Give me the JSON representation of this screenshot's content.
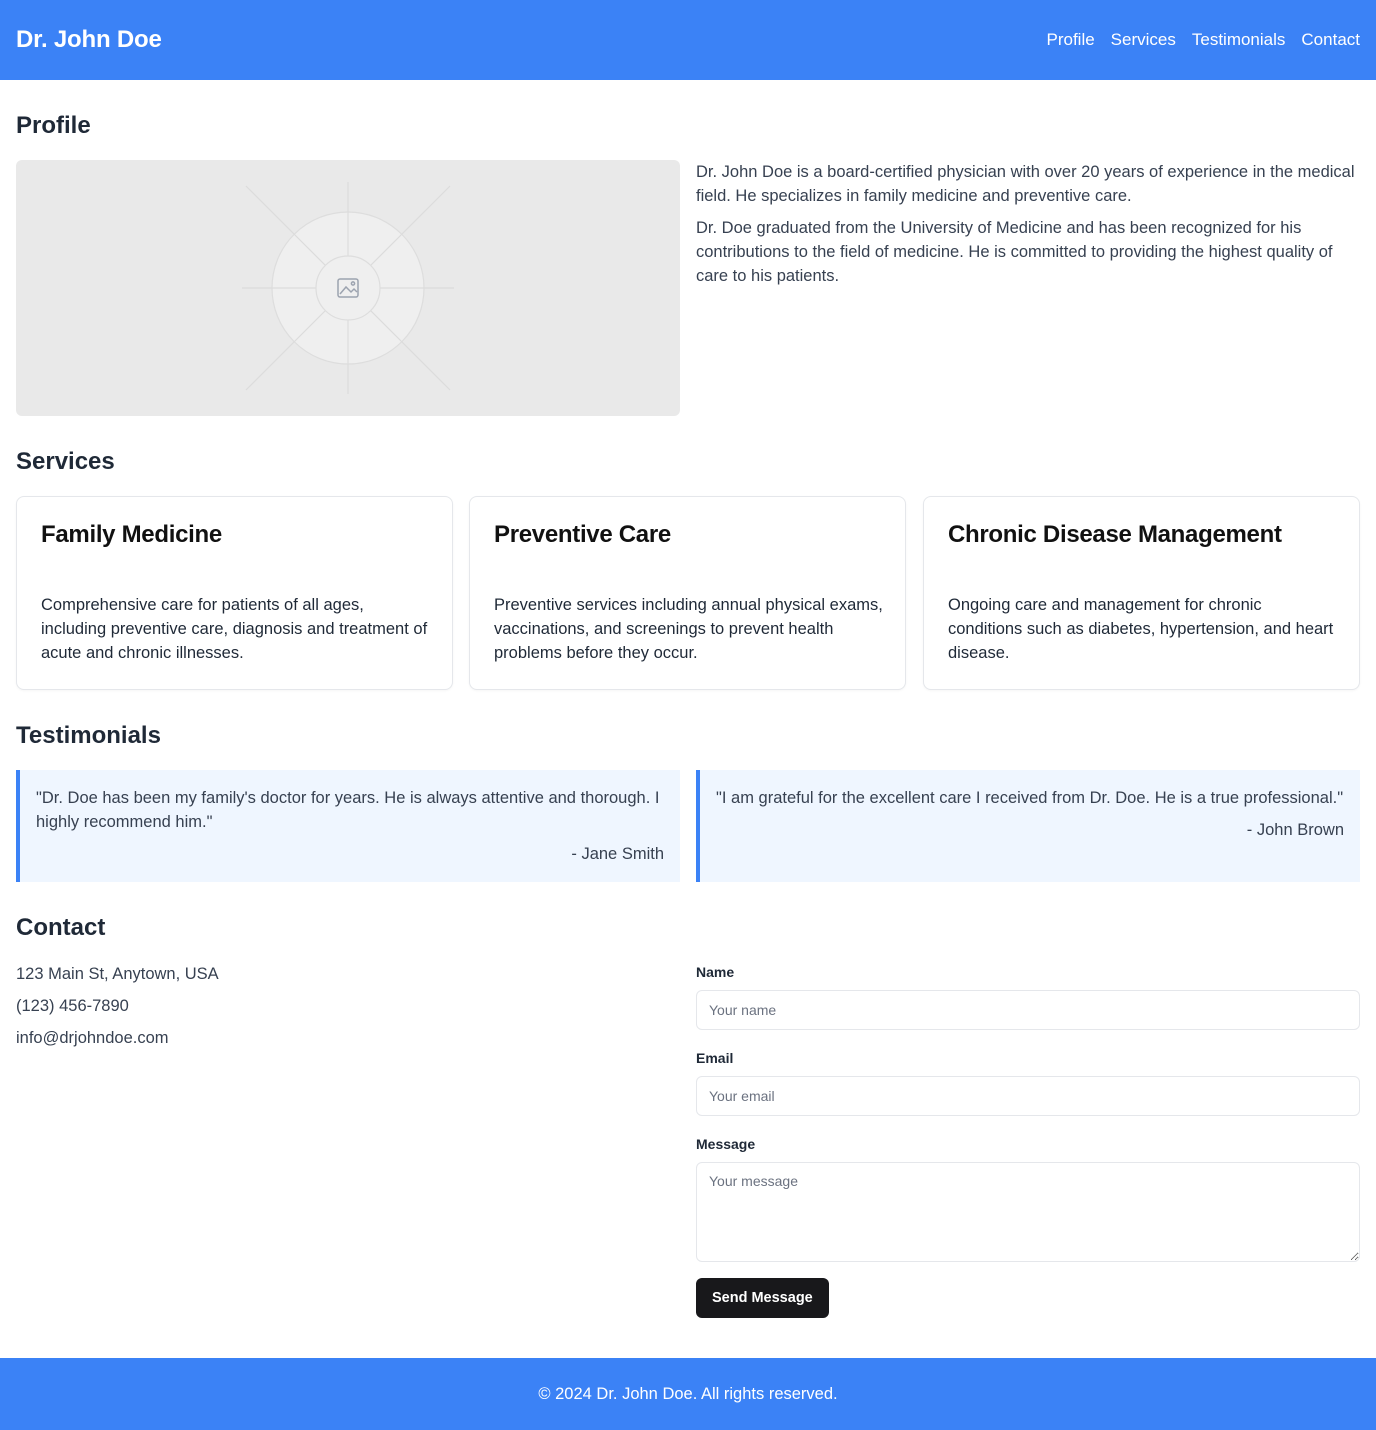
{
  "header": {
    "brand": "Dr. John Doe",
    "nav": [
      "Profile",
      "Services",
      "Testimonials",
      "Contact"
    ]
  },
  "profile": {
    "title": "Profile",
    "image_icon": "image-placeholder-icon",
    "paragraphs": [
      "Dr. John Doe is a board-certified physician with over 20 years of experience in the medical field. He specializes in family medicine and preventive care.",
      "Dr. Doe graduated from the University of Medicine and has been recognized for his contributions to the field of medicine. He is committed to providing the highest quality of care to his patients."
    ]
  },
  "services": {
    "title": "Services",
    "items": [
      {
        "title": "Family Medicine",
        "description": "Comprehensive care for patients of all ages, including preventive care, diagnosis and treatment of acute and chronic illnesses."
      },
      {
        "title": "Preventive Care",
        "description": "Preventive services including annual physical exams, vaccinations, and screenings to prevent health problems before they occur."
      },
      {
        "title": "Chronic Disease Management",
        "description": "Ongoing care and management for chronic conditions such as diabetes, hypertension, and heart disease."
      }
    ]
  },
  "testimonials": {
    "title": "Testimonials",
    "items": [
      {
        "quote": "\"Dr. Doe has been my family's doctor for years. He is always attentive and thorough. I highly recommend him.\"",
        "author": "- Jane Smith"
      },
      {
        "quote": "\"I am grateful for the excellent care I received from Dr. Doe. He is a true professional.\"",
        "author": "- John Brown"
      }
    ]
  },
  "contact": {
    "title": "Contact",
    "address": "123 Main St, Anytown, USA",
    "phone": "(123) 456-7890",
    "email": "info@drjohndoe.com",
    "form": {
      "name_label": "Name",
      "name_placeholder": "Your name",
      "email_label": "Email",
      "email_placeholder": "Your email",
      "message_label": "Message",
      "message_placeholder": "Your message",
      "submit_label": "Send Message"
    }
  },
  "footer": {
    "text": "© 2024 Dr. John Doe. All rights reserved."
  },
  "colors": {
    "primary": "#3b82f6",
    "testimonial_bg": "#eff6ff",
    "button_bg": "#18181b"
  }
}
